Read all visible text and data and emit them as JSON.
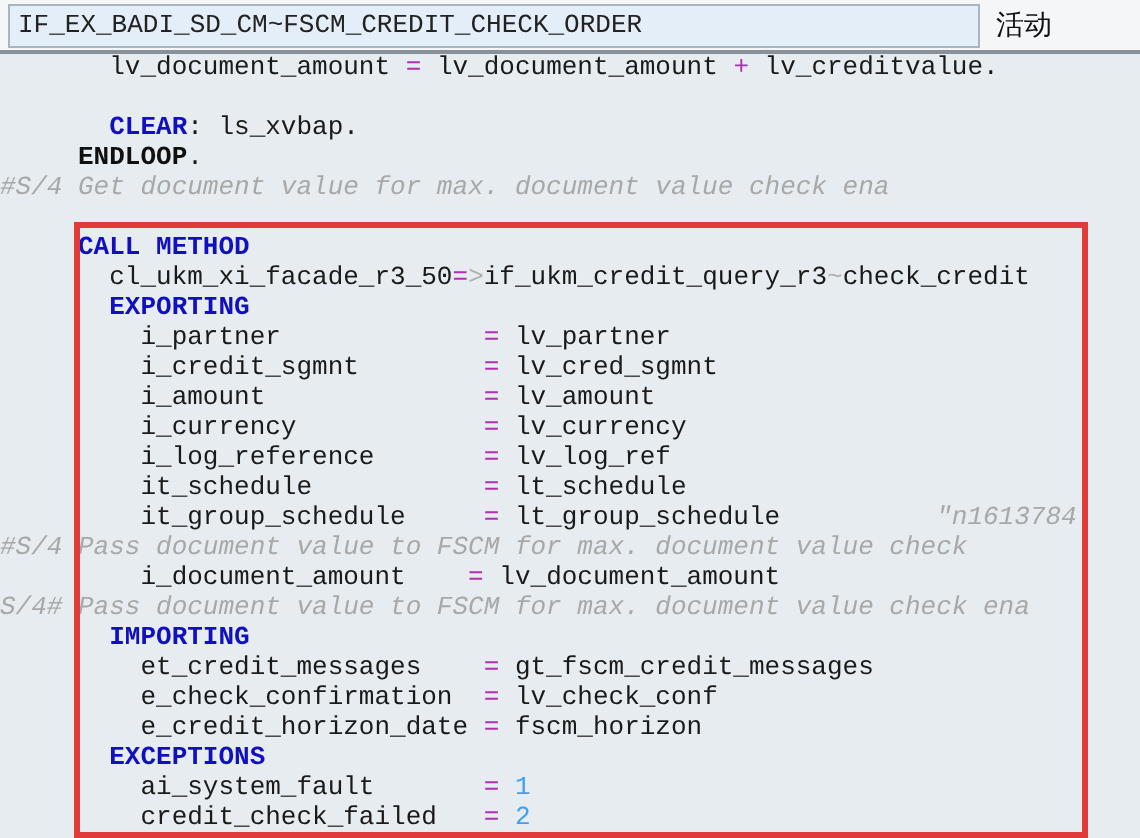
{
  "header": {
    "title_field": "IF_EX_BADI_SD_CM~FSCM_CREDIT_CHECK_ORDER",
    "status": "活动"
  },
  "lines": [
    {
      "kind": "code",
      "tokens": [
        {
          "kind": "id",
          "text": "       lv_document_amount "
        },
        {
          "kind": "op",
          "text": "="
        },
        {
          "kind": "id",
          "text": " lv_document_amount "
        },
        {
          "kind": "op",
          "text": "+"
        },
        {
          "kind": "id",
          "text": " lv_creditvalue."
        }
      ]
    },
    {
      "kind": "blank"
    },
    {
      "kind": "code",
      "tokens": [
        {
          "kind": "kw",
          "text": "       CLEAR"
        },
        {
          "kind": "id",
          "text": ": ls_xvbap."
        }
      ]
    },
    {
      "kind": "code",
      "tokens": [
        {
          "kind": "kwb",
          "text": "     ENDLOOP"
        },
        {
          "kind": "id",
          "text": "."
        }
      ]
    },
    {
      "kind": "code",
      "tokens": [
        {
          "kind": "cm",
          "text": "#S/4 Get document value for max. document value check ena"
        }
      ]
    },
    {
      "kind": "blank"
    },
    {
      "kind": "code",
      "tokens": [
        {
          "kind": "kw",
          "text": "     CALL METHOD"
        }
      ]
    },
    {
      "kind": "code",
      "tokens": [
        {
          "kind": "id",
          "text": "       cl_ukm_xi_facade_r3_50"
        },
        {
          "kind": "op",
          "text": "="
        },
        {
          "kind": "pu",
          "text": ">"
        },
        {
          "kind": "id",
          "text": "if_ukm_credit_query_r3"
        },
        {
          "kind": "pu",
          "text": "~"
        },
        {
          "kind": "id",
          "text": "check_credit"
        }
      ]
    },
    {
      "kind": "code",
      "tokens": [
        {
          "kind": "kw",
          "text": "       EXPORTING"
        }
      ]
    },
    {
      "kind": "code",
      "tokens": [
        {
          "kind": "id",
          "text": "         i_partner             "
        },
        {
          "kind": "op",
          "text": "="
        },
        {
          "kind": "id",
          "text": " lv_partner"
        }
      ]
    },
    {
      "kind": "code",
      "tokens": [
        {
          "kind": "id",
          "text": "         i_credit_sgmnt        "
        },
        {
          "kind": "op",
          "text": "="
        },
        {
          "kind": "id",
          "text": " lv_cred_sgmnt"
        }
      ]
    },
    {
      "kind": "code",
      "tokens": [
        {
          "kind": "id",
          "text": "         i_amount              "
        },
        {
          "kind": "op",
          "text": "="
        },
        {
          "kind": "id",
          "text": " lv_amount"
        }
      ]
    },
    {
      "kind": "code",
      "tokens": [
        {
          "kind": "id",
          "text": "         i_currency            "
        },
        {
          "kind": "op",
          "text": "="
        },
        {
          "kind": "id",
          "text": " lv_currency"
        }
      ]
    },
    {
      "kind": "code",
      "tokens": [
        {
          "kind": "id",
          "text": "         i_log_reference       "
        },
        {
          "kind": "op",
          "text": "="
        },
        {
          "kind": "id",
          "text": " lv_log_ref"
        }
      ]
    },
    {
      "kind": "code",
      "tokens": [
        {
          "kind": "id",
          "text": "         it_schedule           "
        },
        {
          "kind": "op",
          "text": "="
        },
        {
          "kind": "id",
          "text": " lt_schedule"
        }
      ]
    },
    {
      "kind": "code",
      "tokens": [
        {
          "kind": "id",
          "text": "         it_group_schedule     "
        },
        {
          "kind": "op",
          "text": "="
        },
        {
          "kind": "id",
          "text": " lt_group_schedule          "
        },
        {
          "kind": "cm",
          "text": "\"n1613784"
        }
      ]
    },
    {
      "kind": "code",
      "tokens": [
        {
          "kind": "cm",
          "text": "#S/4 Pass document value to FSCM for max. document value check"
        }
      ]
    },
    {
      "kind": "code",
      "tokens": [
        {
          "kind": "id",
          "text": "         i_document_amount    "
        },
        {
          "kind": "op",
          "text": "="
        },
        {
          "kind": "id",
          "text": " lv_document_amount"
        }
      ]
    },
    {
      "kind": "code",
      "tokens": [
        {
          "kind": "cm",
          "text": "S/4# Pass document value to FSCM for max. document value check ena"
        }
      ]
    },
    {
      "kind": "code",
      "tokens": [
        {
          "kind": "kw",
          "text": "       IMPORTING"
        }
      ]
    },
    {
      "kind": "code",
      "tokens": [
        {
          "kind": "id",
          "text": "         et_credit_messages    "
        },
        {
          "kind": "op",
          "text": "="
        },
        {
          "kind": "id",
          "text": " gt_fscm_credit_messages"
        }
      ]
    },
    {
      "kind": "code",
      "tokens": [
        {
          "kind": "id",
          "text": "         e_check_confirmation  "
        },
        {
          "kind": "op",
          "text": "="
        },
        {
          "kind": "id",
          "text": " lv_check_conf"
        }
      ]
    },
    {
      "kind": "code",
      "tokens": [
        {
          "kind": "id",
          "text": "         e_credit_horizon_date "
        },
        {
          "kind": "op",
          "text": "="
        },
        {
          "kind": "id",
          "text": " fscm_horizon"
        }
      ]
    },
    {
      "kind": "code",
      "tokens": [
        {
          "kind": "kw",
          "text": "       EXCEPTIONS"
        }
      ]
    },
    {
      "kind": "code",
      "tokens": [
        {
          "kind": "id",
          "text": "         ai_system_fault       "
        },
        {
          "kind": "op",
          "text": "="
        },
        {
          "kind": "nm",
          "text": " 1"
        }
      ]
    },
    {
      "kind": "code",
      "tokens": [
        {
          "kind": "id",
          "text": "         credit_check_failed   "
        },
        {
          "kind": "op",
          "text": "="
        },
        {
          "kind": "nm",
          "text": " 2"
        }
      ]
    }
  ]
}
